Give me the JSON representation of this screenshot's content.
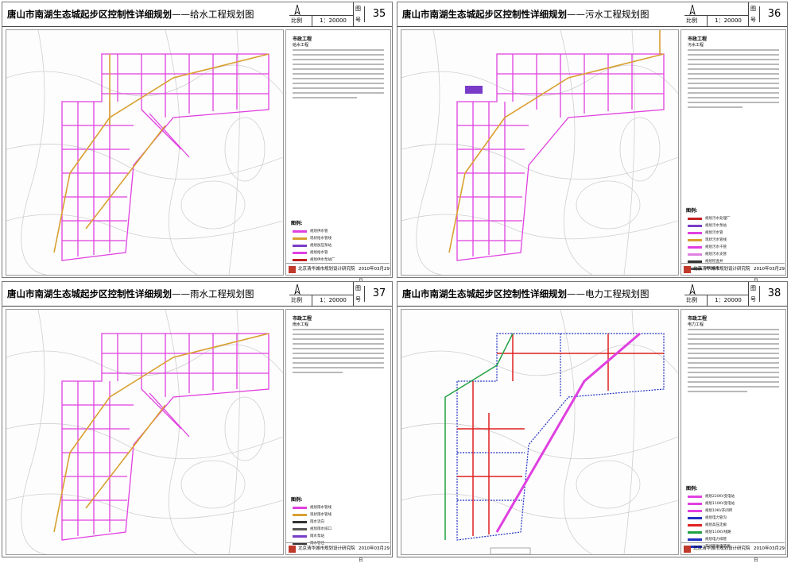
{
  "sheets": [
    {
      "title_main": "唐山市南湖生态城起步区控制性详细规划",
      "title_dash": "——",
      "title_sub": "给水工程规划图",
      "scale_label": "比例",
      "scale_value": "1：20000",
      "fig_label": "图",
      "fig_no_label": "号",
      "fig_number": "35",
      "notes_title": "市政工程",
      "notes_sub": "给水工程",
      "legend_title": "图例:",
      "legend": [
        {
          "label": "规划供水管",
          "color": "#e040e0"
        },
        {
          "label": "现状给水管线",
          "color": "#d9a030"
        },
        {
          "label": "规划加压泵站",
          "color": "#7a3cc8"
        },
        {
          "label": "规划给水管",
          "color": "#e040e0"
        },
        {
          "label": "规划供水泵站厂",
          "color": "#c02020"
        }
      ],
      "institute": "北京清华城市规划设计研究院",
      "date": "2010年03月29日",
      "accent": "#e040e0"
    },
    {
      "title_main": "唐山市南湖生态城起步区控制性详细规划",
      "title_dash": "——",
      "title_sub": "污水工程规划图",
      "scale_label": "比例",
      "scale_value": "1：20000",
      "fig_label": "图",
      "fig_no_label": "号",
      "fig_number": "36",
      "notes_title": "市政工程",
      "notes_sub": "污水工程",
      "legend_title": "图例:",
      "legend": [
        {
          "label": "规划污水处理厂",
          "color": "#c02020"
        },
        {
          "label": "规划污水泵站",
          "color": "#7a3cc8"
        },
        {
          "label": "规划污水管",
          "color": "#e040e0"
        },
        {
          "label": "现状污水管线",
          "color": "#d9a030"
        },
        {
          "label": "规划污水干管",
          "color": "#e040e0"
        },
        {
          "label": "规划污水支管",
          "color": "#e080e0"
        },
        {
          "label": "规划检查井",
          "color": "#333333"
        },
        {
          "label": "规划坡度",
          "color": "#555555"
        }
      ],
      "institute": "北京清华城市规划设计研究院",
      "date": "2010年03月29日",
      "accent": "#e040e0"
    },
    {
      "title_main": "唐山市南湖生态城起步区控制性详细规划",
      "title_dash": "——",
      "title_sub": "雨水工程规划图",
      "scale_label": "比例",
      "scale_value": "1：20000",
      "fig_label": "图",
      "fig_no_label": "号",
      "fig_number": "37",
      "notes_title": "市政工程",
      "notes_sub": "雨水工程",
      "legend_title": "图例:",
      "legend": [
        {
          "label": "规划雨水管线",
          "color": "#e040e0"
        },
        {
          "label": "现状雨水管线",
          "color": "#d9a030"
        },
        {
          "label": "雨水流向",
          "color": "#333333"
        },
        {
          "label": "规划雨水排口",
          "color": "#555555"
        },
        {
          "label": "雨水泵站",
          "color": "#7a3cc8"
        },
        {
          "label": "雨水管径",
          "color": "#333333"
        }
      ],
      "institute": "北京清华城市规划设计研究院",
      "date": "2010年03月29日",
      "accent": "#e040e0"
    },
    {
      "title_main": "唐山市南湖生态城起步区控制性详细规划",
      "title_dash": "——",
      "title_sub": "电力工程规划图",
      "scale_label": "比例",
      "scale_value": "1：20000",
      "fig_label": "图",
      "fig_no_label": "号",
      "fig_number": "38",
      "notes_title": "市政工程",
      "notes_sub": "电力工程",
      "legend_title": "图例:",
      "legend": [
        {
          "label": "规划220KV变电站",
          "color": "#e040e0"
        },
        {
          "label": "规划110KV变电站",
          "color": "#e040e0"
        },
        {
          "label": "规划10KV开闭所",
          "color": "#e040e0"
        },
        {
          "label": "规划电力管沟",
          "color": "#2030c0"
        },
        {
          "label": "规划高压走廊",
          "color": "#e02020"
        },
        {
          "label": "规划110KV线路",
          "color": "#20a040"
        },
        {
          "label": "规划电力排管",
          "color": "#2030c0"
        },
        {
          "label": "开闭所供电范围",
          "color": "#2030c0"
        }
      ],
      "institute": "北京清华城市规划设计研究院",
      "date": "2010年03月29日",
      "accent": "#2030c0"
    }
  ]
}
